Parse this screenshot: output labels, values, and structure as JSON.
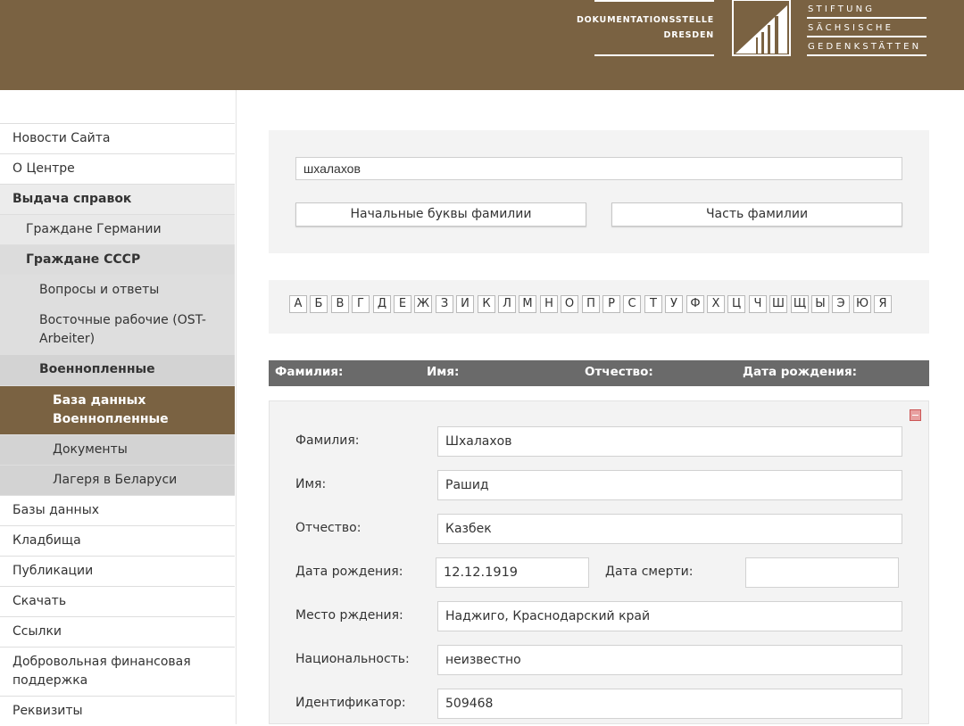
{
  "header": {
    "doc_line1": "DOKUMENTATIONSSTELLE",
    "doc_line2": "DRESDEN",
    "foundation_line1": "STIFTUNG",
    "foundation_line2": "SÄCHSISCHE",
    "foundation_line3": "GEDENKSTÄTTEN",
    "logo": "stiftung-logo",
    "color": "#7a6242"
  },
  "sidebar": {
    "items": [
      {
        "label": "Новости Сайта"
      },
      {
        "label": "О Центре"
      },
      {
        "label": "Выдача справок"
      },
      {
        "label": "Граждане Германии"
      },
      {
        "label": "Граждане СССР"
      },
      {
        "label": "Вопросы и ответы"
      },
      {
        "label": "Восточные рабочие (OST-Arbeiter)"
      },
      {
        "label": "Военнопленные"
      },
      {
        "label": "База данных Военнопленные"
      },
      {
        "label": "Документы"
      },
      {
        "label": "Лагеря в Беларуси"
      },
      {
        "label": "Базы данных"
      },
      {
        "label": "Кладбища"
      },
      {
        "label": "Публикации"
      },
      {
        "label": "Скачать"
      },
      {
        "label": "Ссылки"
      },
      {
        "label": "Добровольная финансовая поддержка"
      },
      {
        "label": "Реквизиты"
      }
    ]
  },
  "search": {
    "value": "шхалахов",
    "btn_initial": "Начальные буквы фамилии",
    "btn_part": "Часть фамилии"
  },
  "alphabet": [
    "А",
    "Б",
    "В",
    "Г",
    "Д",
    "Е",
    "Ж",
    "З",
    "И",
    "К",
    "Л",
    "М",
    "Н",
    "О",
    "П",
    "Р",
    "С",
    "Т",
    "У",
    "Ф",
    "Х",
    "Ц",
    "Ч",
    "Ш",
    "Щ",
    "Ы",
    "Э",
    "Ю",
    "Я"
  ],
  "results": {
    "col_surname": "Фамилия:",
    "col_name": "Имя:",
    "col_patronymic": "Отчество:",
    "col_birth": "Дата рождения:"
  },
  "detail": {
    "surname_label": "Фамилия:",
    "surname": "Шхалахов",
    "name_label": "Имя:",
    "name": "Рашид",
    "patronymic_label": "Отчество:",
    "patronymic": "Казбек",
    "birth_label": "Дата рождения:",
    "birth": "12.12.1919",
    "death_label": "Дата смерти:",
    "death": "",
    "birthplace_label": "Место рждения:",
    "birthplace": "Наджиго, Краснодарский край",
    "nationality_label": "Национальность:",
    "nationality": "неизвестно",
    "id_label": "Идентификатор:",
    "id": "509468"
  }
}
